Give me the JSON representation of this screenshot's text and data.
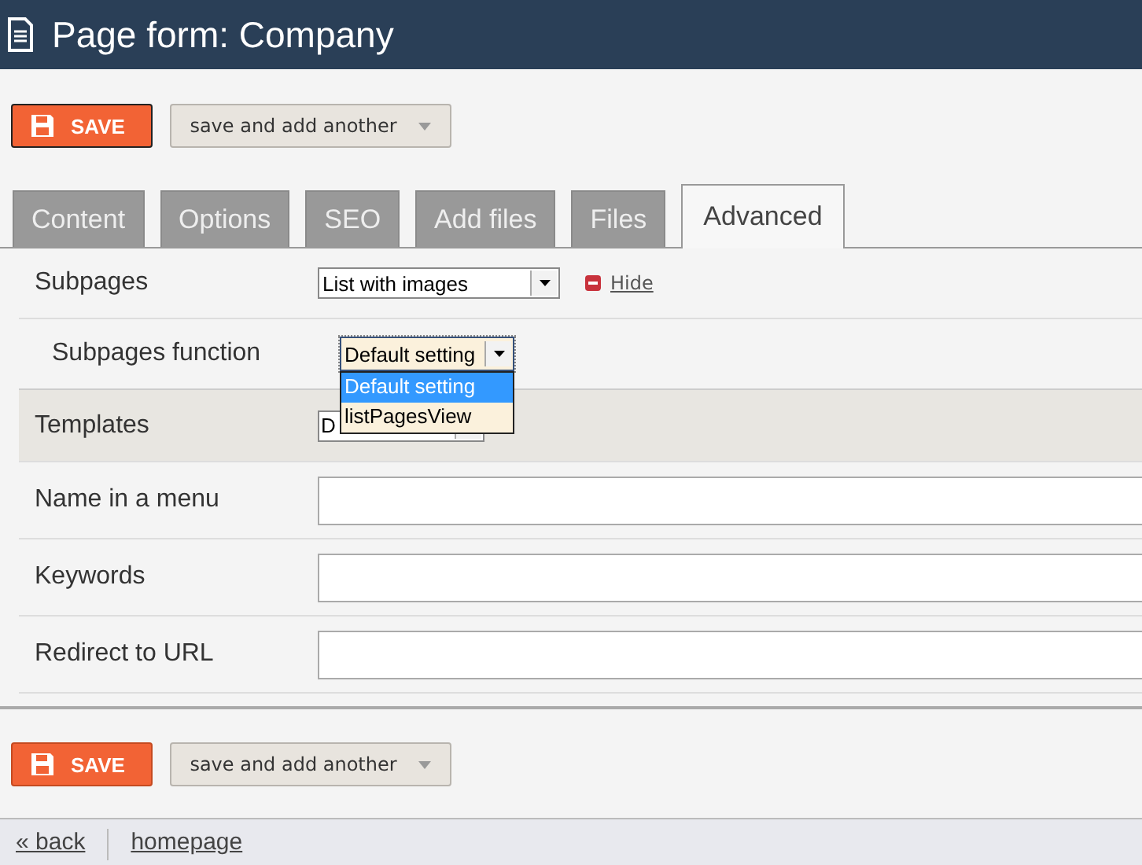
{
  "window": {
    "title": "Page form: Company"
  },
  "top_actions": {
    "save": "SAVE",
    "secondary": "save and add another"
  },
  "tabs": [
    {
      "label": "Content",
      "selected": false
    },
    {
      "label": "Options",
      "selected": false
    },
    {
      "label": "SEO",
      "selected": false
    },
    {
      "label": "Add files",
      "selected": false
    },
    {
      "label": "Files",
      "selected": false
    },
    {
      "label": "Advanced",
      "selected": true
    }
  ],
  "fields": [
    {
      "kind": "select",
      "label": "Subpages",
      "value": "List with images",
      "hide_link": "Hide",
      "nested": false,
      "shaded": false
    },
    {
      "kind": "select",
      "label": "Subpages function",
      "value": "Default setting",
      "nested": true,
      "shaded": false,
      "open": true,
      "options": [
        {
          "label": "Default setting",
          "selected": true
        },
        {
          "label": "listPagesView",
          "selected": false
        }
      ]
    },
    {
      "kind": "select",
      "label": "Templates",
      "value": "D",
      "nested": false,
      "shaded": true
    },
    {
      "kind": "input",
      "label": "Name in a menu",
      "nested": false,
      "shaded": false
    },
    {
      "kind": "input",
      "label": "Keywords",
      "nested": false,
      "shaded": false
    },
    {
      "kind": "input",
      "label": "Redirect to URL",
      "nested": false,
      "shaded": false
    }
  ],
  "bottom_actions": {
    "save": "SAVE",
    "secondary": "save and add another"
  },
  "footer_links": [
    "« back",
    "homepage"
  ]
}
